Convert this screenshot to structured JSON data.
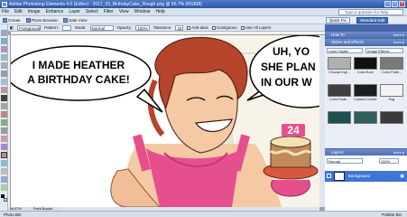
{
  "window": {
    "title": "Adobe Photoshop Elements 4.0 (Editor) - 2012_03_BirthdayCake_Rough.png @ 66.7% (RGB/8)"
  },
  "menu": [
    "File",
    "Edit",
    "Image",
    "Enhance",
    "Layer",
    "Select",
    "Filter",
    "View",
    "Window",
    "Help"
  ],
  "help_box": {
    "placeholder": "Type a question for help"
  },
  "toolbar": {
    "create": "Create",
    "photo_browser": "Photo Browser",
    "date_view": "Date View"
  },
  "modes": {
    "quick_fix": "Quick Fix",
    "standard_edit": "Standard Edit"
  },
  "options": {
    "mode_select": "Foreground",
    "pattern_label": "Pattern:",
    "mode_label": "Mode:",
    "mode_value": "Normal",
    "opacity_label": "Opacity:",
    "opacity_value": "100%",
    "tolerance_label": "Tolerance:",
    "tolerance_value": "32",
    "antialias_label": "Anti-alias",
    "contiguous_label": "Contiguous",
    "all_layers_label": "Use All Layers"
  },
  "canvas": {
    "speech_left_line1": "I MADE HEATHER",
    "speech_left_line2": "A BIRTHDAY CAKE!",
    "speech_right_line1": "UH, YO",
    "speech_right_line2": "SHE PLAN",
    "speech_right_line3": "IN OUR W",
    "candle": "24"
  },
  "status": {
    "zoom": "66.67%",
    "tool": "Paint Bucket"
  },
  "panels": {
    "how_to": "How To",
    "styles_title": "Styles and Effects",
    "more": "more ▸",
    "styles_dropdown": "Layer Styles",
    "effects_dropdown": "Image Effects",
    "layers_title": "Layers",
    "layer_mode": "Normal",
    "layer_opacity": "100%",
    "layer_name": "Background"
  },
  "styles": [
    {
      "label": "Circular Ingr...",
      "color": "#b0b0b0"
    },
    {
      "label": "Color Burn",
      "color": "#101010"
    },
    {
      "label": "Color Fade...",
      "color": "#7a7a7a"
    },
    {
      "label": "Color Fade...",
      "color": "#3f3f3f"
    },
    {
      "label": "Colorful Center",
      "color": "#1c1c1c"
    },
    {
      "label": "Fog",
      "color": "#f2f2f2"
    },
    {
      "label": "",
      "color": "#1d4f4f"
    },
    {
      "label": "",
      "color": "#2f5f5f"
    },
    {
      "label": "",
      "color": "#3b3b3b"
    }
  ],
  "taskbar": {
    "photo_bin": "Photo Bin",
    "palette_bin": "Palette Bin"
  }
}
